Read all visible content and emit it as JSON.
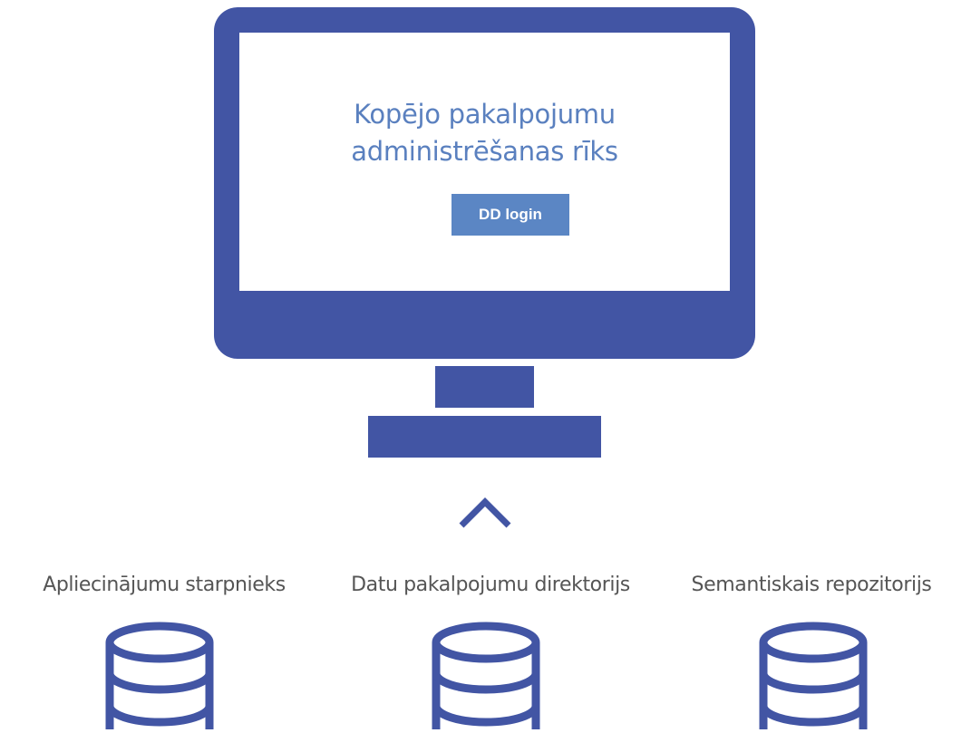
{
  "screen": {
    "title_line1": "Kopējo pakalpojumu",
    "title_line2": "administrēšanas rīks",
    "login_button": "DD login"
  },
  "databases": [
    {
      "label": "Apliecinājumu starpnieks",
      "icon": "database-icon"
    },
    {
      "label": "Datu pakalpojumu direktorijs",
      "icon": "database-icon"
    },
    {
      "label": "Semantiskais repozitorijs",
      "icon": "database-icon"
    }
  ],
  "colors": {
    "primary": "#4255a4",
    "accent_text": "#5a80bf",
    "button": "#5b86c4",
    "label_text": "#555555"
  }
}
